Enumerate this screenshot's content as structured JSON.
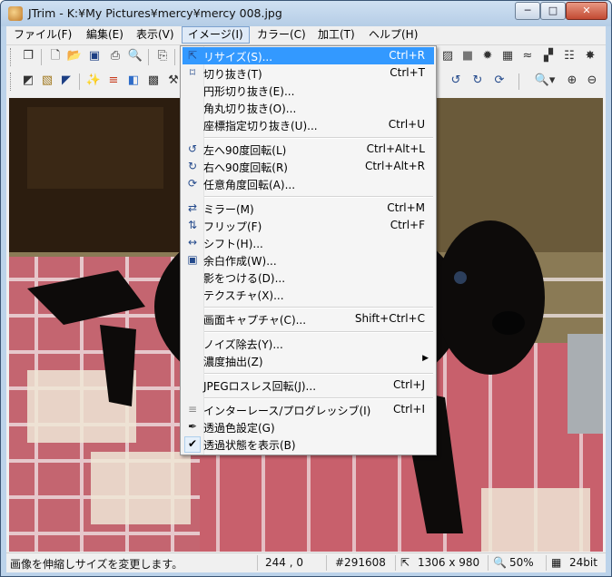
{
  "window": {
    "title": "JTrim - K:¥My Pictures¥mercy¥mercy 008.jpg",
    "controls": {
      "minimize": "─",
      "maximize": "□",
      "close": "✕"
    }
  },
  "menubar": {
    "items": [
      {
        "label": "ファイル(F)"
      },
      {
        "label": "編集(E)"
      },
      {
        "label": "表示(V)"
      },
      {
        "label": "イメージ(I)"
      },
      {
        "label": "カラー(C)"
      },
      {
        "label": "加工(T)"
      },
      {
        "label": "ヘルプ(H)"
      }
    ]
  },
  "toolbar1": {
    "icons": [
      "grip-icon",
      "new-window-icon",
      "new-file-icon",
      "open-folder-icon",
      "save-icon",
      "print-icon",
      "print-preview-icon",
      "copy-icon",
      "paste-icon"
    ],
    "right_icons": [
      "frame-icon",
      "solid-fill-icon",
      "sunburst-icon",
      "mosaic-icon",
      "wave-icon",
      "stipple-icon",
      "brick-icon",
      "sparkle-icon"
    ]
  },
  "toolbar2": {
    "right_icons": [
      "rotate-left-90-icon",
      "rotate-right-90-icon",
      "rotate-free-icon",
      "zoom-icon",
      "zoom-in-icon",
      "zoom-out-icon"
    ]
  },
  "image_menu": {
    "items": [
      {
        "label": "リサイズ(S)...",
        "shortcut": "Ctrl+R",
        "icon": "resize-icon",
        "highlighted": true
      },
      {
        "label": "切り抜き(T)",
        "shortcut": "Ctrl+T",
        "icon": "crop-icon"
      },
      {
        "label": "円形切り抜き(E)...",
        "shortcut": ""
      },
      {
        "label": "角丸切り抜き(O)...",
        "shortcut": ""
      },
      {
        "label": "座標指定切り抜き(U)...",
        "shortcut": "Ctrl+U"
      },
      {
        "label": "左へ90度回転(L)",
        "shortcut": "Ctrl+Alt+L",
        "icon": "rotate-left-90-icon"
      },
      {
        "label": "右へ90度回転(R)",
        "shortcut": "Ctrl+Alt+R",
        "icon": "rotate-right-90-icon"
      },
      {
        "label": "任意角度回転(A)...",
        "shortcut": "",
        "icon": "rotate-free-icon"
      },
      {
        "label": "ミラー(M)",
        "shortcut": "Ctrl+M",
        "icon": "mirror-icon"
      },
      {
        "label": "フリップ(F)",
        "shortcut": "Ctrl+F",
        "icon": "flip-icon"
      },
      {
        "label": "シフト(H)...",
        "shortcut": "",
        "icon": "shift-icon"
      },
      {
        "label": "余白作成(W)...",
        "shortcut": "",
        "icon": "margin-icon"
      },
      {
        "label": "影をつける(D)...",
        "shortcut": ""
      },
      {
        "label": "テクスチャ(X)...",
        "shortcut": ""
      },
      {
        "label": "画面キャプチャ(C)...",
        "shortcut": "Shift+Ctrl+C"
      },
      {
        "label": "ノイズ除去(Y)...",
        "shortcut": ""
      },
      {
        "label": "濃度抽出(Z)",
        "shortcut": "",
        "submenu": true
      },
      {
        "label": "JPEGロスレス回転(J)...",
        "shortcut": "Ctrl+J"
      },
      {
        "label": "インターレース/プログレッシブ(I)",
        "shortcut": "Ctrl+I",
        "icon": "interlace-icon"
      },
      {
        "label": "透過色設定(G)",
        "shortcut": "",
        "icon": "eyedropper-icon"
      },
      {
        "label": "透過状態を表示(B)",
        "shortcut": "",
        "icon": "check-icon",
        "checked": true
      }
    ]
  },
  "statusbar": {
    "message": "画像を伸縮しサイズを変更します。",
    "cursor": "244 , 0",
    "color": "#291608",
    "dimensions": "1306 x 980",
    "zoom": "50%",
    "depth": "24bit"
  }
}
